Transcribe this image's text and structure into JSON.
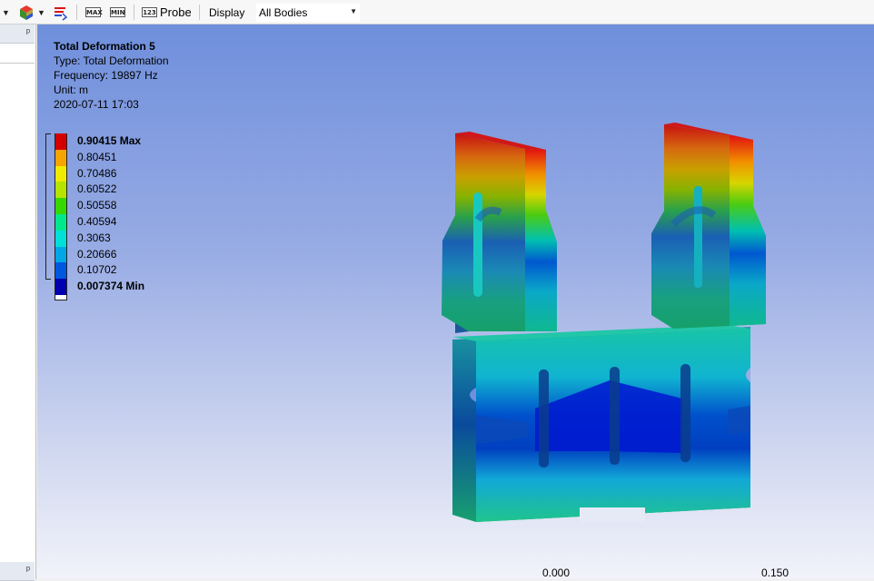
{
  "toolbar": {
    "max_label": "MAX",
    "min_label": "MIN",
    "probe_icon_label": "123",
    "probe_label": "Probe",
    "display_label": "Display",
    "display_value": "All Bodies"
  },
  "result": {
    "title": "Total Deformation 5",
    "type": "Type: Total Deformation",
    "frequency": "Frequency: 19897 Hz",
    "unit": "Unit: m",
    "date": "2020-07-11 17:03"
  },
  "legend": {
    "entries": [
      {
        "label": "0.90415 Max",
        "color": "#d40000",
        "bold": true
      },
      {
        "label": "0.80451",
        "color": "#f5a400"
      },
      {
        "label": "0.70486",
        "color": "#f0ea00"
      },
      {
        "label": "0.60522",
        "color": "#b4e400"
      },
      {
        "label": "0.50558",
        "color": "#36d800"
      },
      {
        "label": "0.40594",
        "color": "#00e88c"
      },
      {
        "label": "0.3063",
        "color": "#00e0d8"
      },
      {
        "label": "0.20666",
        "color": "#00a6e6"
      },
      {
        "label": "0.10702",
        "color": "#0058e0"
      },
      {
        "label": "0.007374 Min",
        "color": "#0000b0",
        "bold": true
      }
    ]
  },
  "scale": {
    "left": "0.000",
    "right": "0.150"
  },
  "colors": {
    "viewport_top": "#6f8fdc",
    "viewport_bottom": "#f2f3fa",
    "panel_header": "#e4e9f2"
  }
}
